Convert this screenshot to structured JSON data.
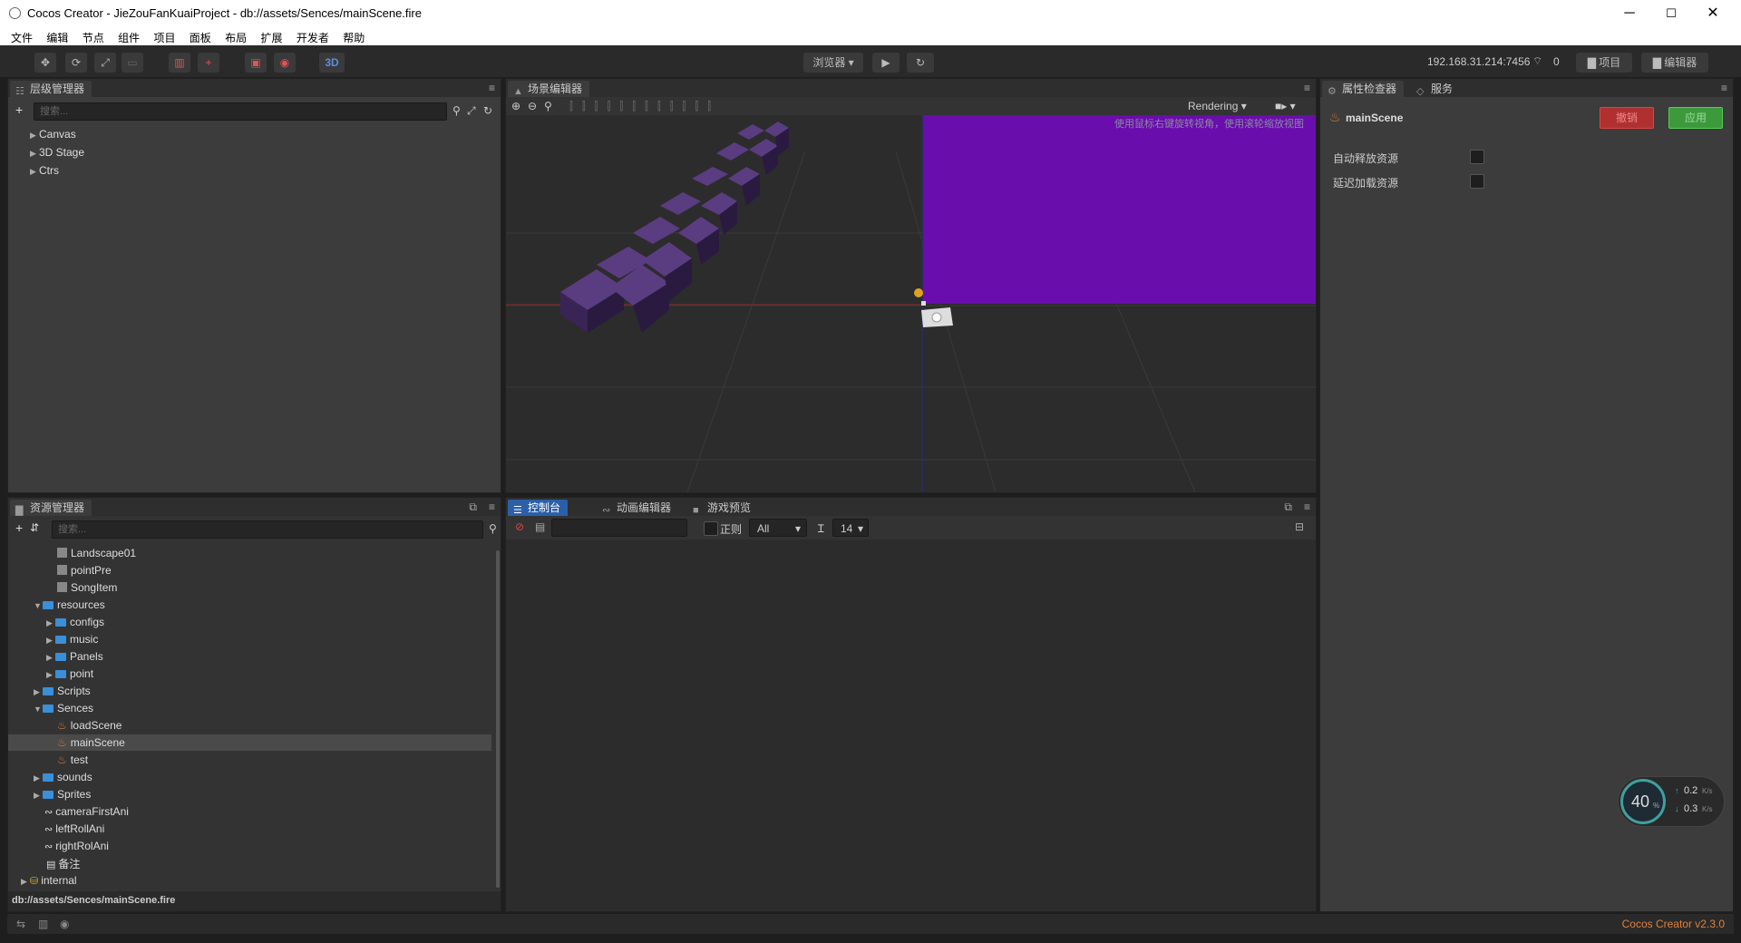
{
  "window": {
    "title": "Cocos Creator - JieZouFanKuaiProject - db://assets/Sences/mainScene.fire",
    "min": "─",
    "max": "☐",
    "close": "✕"
  },
  "menu": [
    "文件",
    "编辑",
    "节点",
    "组件",
    "项目",
    "面板",
    "布局",
    "扩展",
    "开发者",
    "帮助"
  ],
  "toolbar": {
    "mode_3d": "3D",
    "preview_select": "浏览器 ▾",
    "play": "▶",
    "refresh": "↻",
    "ip": "192.168.31.214:7456",
    "ip_count": "0",
    "project_btn": "项目",
    "editor_btn": "编辑器"
  },
  "hierarchy": {
    "tab": "层级管理器",
    "search_placeholder": "搜索...",
    "items": [
      "Canvas",
      "3D Stage",
      "Ctrs"
    ]
  },
  "scene": {
    "tab": "场景编辑器",
    "rendering": "Rendering",
    "hint": "使用鼠标右键旋转视角，使用滚轮缩放视图",
    "colors": {
      "purple": "#6a0dad",
      "cube": "#3d2a55"
    }
  },
  "inspector": {
    "tab": "属性检查器",
    "tab2": "服务",
    "asset_name": "mainScene",
    "revert": "撤销",
    "apply": "应用",
    "props": [
      "自动释放资源",
      "延迟加载资源"
    ]
  },
  "assets": {
    "tab": "资源管理器",
    "search_placeholder": "搜索...",
    "items": [
      {
        "label": "Landscape01",
        "type": "prefab",
        "level": 3,
        "arrow": ""
      },
      {
        "label": "pointPre",
        "type": "prefab",
        "level": 3,
        "arrow": ""
      },
      {
        "label": "SongItem",
        "type": "prefab",
        "level": 3,
        "arrow": ""
      },
      {
        "label": "resources",
        "type": "folder",
        "level": 2,
        "arrow": "▼"
      },
      {
        "label": "configs",
        "type": "folder",
        "level": 3,
        "arrow": "▶"
      },
      {
        "label": "music",
        "type": "folder",
        "level": 3,
        "arrow": "▶"
      },
      {
        "label": "Panels",
        "type": "folder",
        "level": 3,
        "arrow": "▶"
      },
      {
        "label": "point",
        "type": "folder",
        "level": 3,
        "arrow": "▶"
      },
      {
        "label": "Scripts",
        "type": "folder",
        "level": 2,
        "arrow": "▶"
      },
      {
        "label": "Sences",
        "type": "folder",
        "level": 2,
        "arrow": "▼"
      },
      {
        "label": "loadScene",
        "type": "fire",
        "level": 3,
        "arrow": ""
      },
      {
        "label": "mainScene",
        "type": "fire",
        "level": 3,
        "arrow": "",
        "selected": true
      },
      {
        "label": "test",
        "type": "fire",
        "level": 3,
        "arrow": ""
      },
      {
        "label": "sounds",
        "type": "folder",
        "level": 2,
        "arrow": "▶"
      },
      {
        "label": "Sprites",
        "type": "folder",
        "level": 2,
        "arrow": "▶"
      },
      {
        "label": "cameraFirstAni",
        "type": "ani",
        "level": 2,
        "arrow": ""
      },
      {
        "label": "leftRollAni",
        "type": "ani",
        "level": 2,
        "arrow": ""
      },
      {
        "label": "rightRolAni",
        "type": "ani",
        "level": 2,
        "arrow": ""
      },
      {
        "label": "备注",
        "type": "doc",
        "level": 2,
        "arrow": ""
      },
      {
        "label": "internal",
        "type": "db",
        "level": 1,
        "arrow": "▶"
      }
    ],
    "path": "db://assets/Sences/mainScene.fire"
  },
  "console": {
    "tab": "控制台",
    "tab2": "动画编辑器",
    "tab3": "游戏预览",
    "regex": "正则",
    "level": "All",
    "fontsize": "14"
  },
  "status": {
    "version": "Cocos Creator v2.3.0"
  },
  "netmeter": {
    "percent": "40",
    "unit": "%",
    "up": "0.2",
    "down": "0.3",
    "rate_unit": "K/s"
  }
}
